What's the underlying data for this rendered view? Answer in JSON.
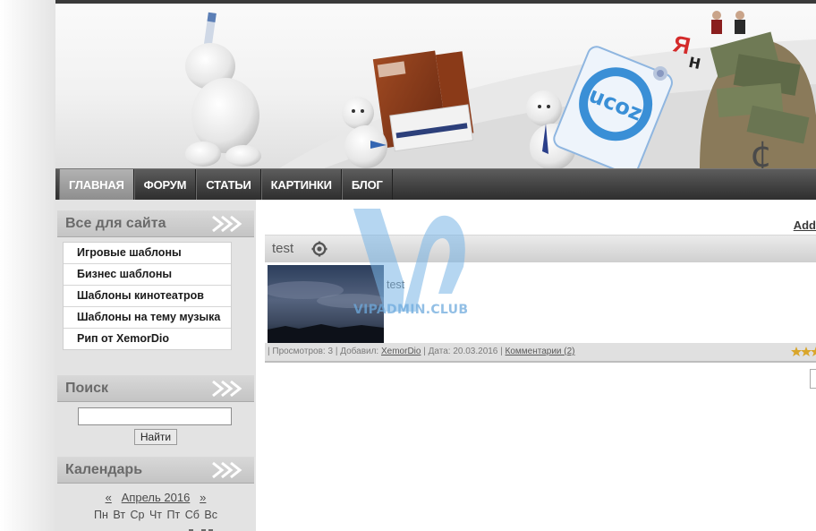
{
  "nav": {
    "items": [
      {
        "label": "ГЛАВНАЯ",
        "active": true
      },
      {
        "label": "ФОРУМ",
        "active": false
      },
      {
        "label": "СТАТЬИ",
        "active": false
      },
      {
        "label": "КАРТИНКИ",
        "active": false
      },
      {
        "label": "БЛОГ",
        "active": false
      }
    ]
  },
  "header": {
    "banner_brand": "ucoz"
  },
  "sidebar": {
    "site_block": {
      "title": "Все для сайта",
      "items": [
        "Игровые шаблоны",
        "Бизнес шаблоны",
        "Шаблоны кинотеатров",
        "Шаблоны на тему музыка",
        "Рип от XemorDio"
      ]
    },
    "search_block": {
      "title": "Поиск",
      "input_value": "",
      "button_label": "Найти"
    },
    "calendar_block": {
      "title": "Календарь",
      "prev": "«",
      "month": "Апрель 2016",
      "next": "»",
      "weekdays": "Пн Вт Ср Чт Пт Сб Вс"
    }
  },
  "content": {
    "add_link": "Add",
    "entry": {
      "title": "test",
      "text": "test",
      "views_label": "| Просмотров: 3 | Добавил: ",
      "author": "XemorDio",
      "date_label": " | Дата: 20.03.2016 | ",
      "comments": "Комментарии (2)"
    }
  },
  "watermark": "VIPADMIN.CLUB",
  "colors": {
    "nav_bg": "#424242",
    "nav_active": "#9a9a9a",
    "sidebar_bg": "#e3e3e3",
    "watermark": "#6aaadc"
  }
}
